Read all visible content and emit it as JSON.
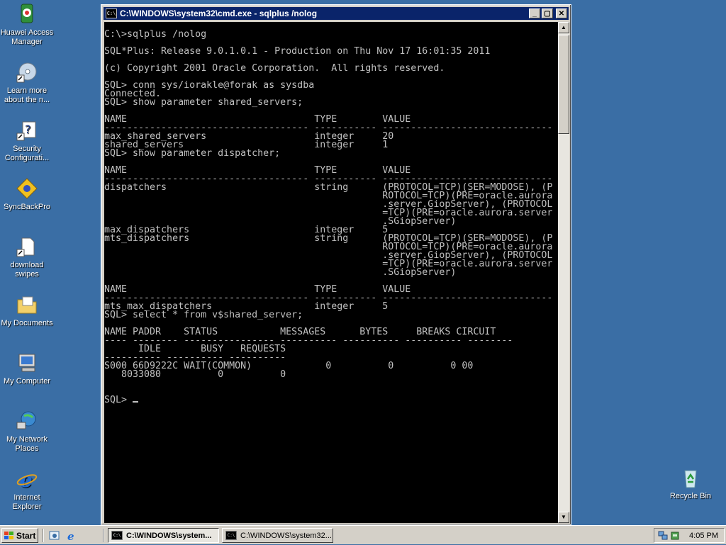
{
  "desktop": {
    "icons": [
      {
        "label": "Huawei Access Manager",
        "icon": "huawei-icon"
      },
      {
        "label": "Learn more about the n...",
        "icon": "cd-icon"
      },
      {
        "label": "Security Configurati...",
        "icon": "security-config-icon"
      },
      {
        "label": "SyncBackPro",
        "icon": "syncback-icon"
      },
      {
        "label": "download swipes",
        "icon": "file-icon"
      },
      {
        "label": "My Documents",
        "icon": "folder-icon"
      },
      {
        "label": "My Computer",
        "icon": "computer-icon"
      },
      {
        "label": "My Network Places",
        "icon": "network-icon"
      },
      {
        "label": "Internet Explorer",
        "icon": "ie-icon"
      },
      {
        "label": "Recycle Bin",
        "icon": "recycle-bin-icon"
      }
    ]
  },
  "window": {
    "title": "C:\\WINDOWS\\system32\\cmd.exe - sqlplus /nolog",
    "icon_text": "C:\\",
    "minimize": "_",
    "maximize": "▢",
    "close": "✕"
  },
  "console": {
    "lines": [
      "C:\\>sqlplus /nolog",
      "",
      "SQL*Plus: Release 9.0.1.0.1 - Production on Thu Nov 17 16:01:35 2011",
      "",
      "(c) Copyright 2001 Oracle Corporation.  All rights reserved.",
      "",
      "SQL> conn sys/iorakle@forak as sysdba",
      "Connected.",
      "SQL> show parameter shared_servers;",
      "",
      "NAME                                 TYPE        VALUE",
      "------------------------------------ ----------- ------------------------------",
      "max_shared_servers                   integer     20",
      "shared_servers                       integer     1",
      "SQL> show parameter dispatcher;",
      "",
      "NAME                                 TYPE        VALUE",
      "------------------------------------ ----------- ------------------------------",
      "dispatchers                          string      (PROTOCOL=TCP)(SER=MODOSE), (P",
      "                                                 ROTOCOL=TCP)(PRE=oracle.aurora",
      "                                                 .server.GiopServer), (PROTOCOL",
      "                                                 =TCP)(PRE=oracle.aurora.server",
      "                                                 .SGiopServer)",
      "max_dispatchers                      integer     5",
      "mts_dispatchers                      string      (PROTOCOL=TCP)(SER=MODOSE), (P",
      "                                                 ROTOCOL=TCP)(PRE=oracle.aurora",
      "                                                 .server.GiopServer), (PROTOCOL",
      "                                                 =TCP)(PRE=oracle.aurora.server",
      "                                                 .SGiopServer)",
      "",
      "NAME                                 TYPE        VALUE",
      "------------------------------------ ----------- ------------------------------",
      "mts_max_dispatchers                  integer     5",
      "SQL> select * from v$shared_server;",
      "",
      "NAME PADDR    STATUS           MESSAGES      BYTES     BREAKS CIRCUIT",
      "---- -------- ---------------- ---------- ---------- ---------- --------",
      "      IDLE       BUSY   REQUESTS",
      "---------- ---------- ----------",
      "S000 66D9222C WAIT(COMMON)             0          0          0 00",
      "   8033080          0          0",
      "",
      "",
      "SQL> "
    ]
  },
  "taskbar": {
    "start_label": "Start",
    "tasks": [
      {
        "label": "C:\\WINDOWS\\system...",
        "active": true
      },
      {
        "label": "C:\\WINDOWS\\system32...",
        "active": false
      }
    ],
    "clock": "4:05 PM"
  }
}
